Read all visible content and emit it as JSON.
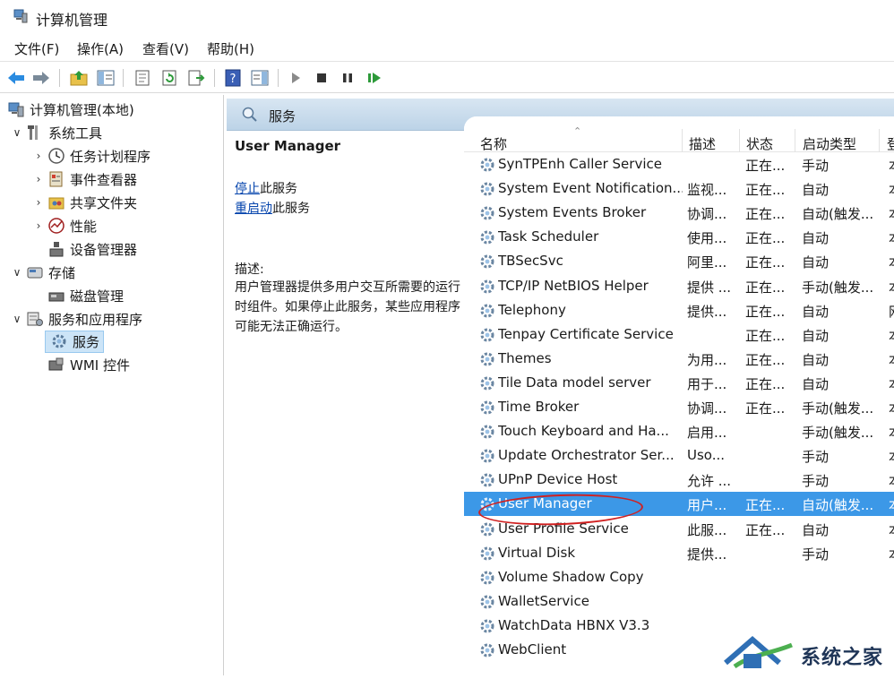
{
  "window": {
    "title": "计算机管理"
  },
  "menu": [
    {
      "label": "文件(F)"
    },
    {
      "label": "操作(A)"
    },
    {
      "label": "查看(V)"
    },
    {
      "label": "帮助(H)"
    }
  ],
  "tree": {
    "root": "计算机管理(本地)",
    "system_tools": "系统工具",
    "task_scheduler": "任务计划程序",
    "event_viewer": "事件查看器",
    "shared_folders": "共享文件夹",
    "performance": "性能",
    "device_manager": "设备管理器",
    "storage": "存储",
    "disk_management": "磁盘管理",
    "services_apps": "服务和应用程序",
    "services": "服务",
    "wmi": "WMI 控件"
  },
  "header": {
    "title": "服务"
  },
  "details": {
    "service_name": "User Manager",
    "stop_link": "停止",
    "stop_suffix": "此服务",
    "restart_link": "重启动",
    "restart_suffix": "此服务",
    "desc_label": "描述:",
    "description": "用户管理器提供多用户交互所需要的运行时组件。如果停止此服务，某些应用程序可能无法正确运行。"
  },
  "columns": {
    "name": "名称",
    "description": "描述",
    "status": "状态",
    "startup": "启动类型",
    "logon": "登"
  },
  "rows": [
    {
      "name": "SynTPEnh Caller Service",
      "description": "",
      "status": "正在...",
      "startup": "手动",
      "logon": "本"
    },
    {
      "name": "System Event Notification...",
      "description": "监视...",
      "status": "正在...",
      "startup": "自动",
      "logon": "本"
    },
    {
      "name": "System Events Broker",
      "description": "协调...",
      "status": "正在...",
      "startup": "自动(触发...",
      "logon": "本"
    },
    {
      "name": "Task Scheduler",
      "description": "使用...",
      "status": "正在...",
      "startup": "自动",
      "logon": "本"
    },
    {
      "name": "TBSecSvc",
      "description": "阿里...",
      "status": "正在...",
      "startup": "自动",
      "logon": "本"
    },
    {
      "name": "TCP/IP NetBIOS Helper",
      "description": "提供 ...",
      "status": "正在...",
      "startup": "手动(触发...",
      "logon": "本"
    },
    {
      "name": "Telephony",
      "description": "提供...",
      "status": "正在...",
      "startup": "自动",
      "logon": "网"
    },
    {
      "name": "Tenpay Certificate Service",
      "description": "",
      "status": "正在...",
      "startup": "自动",
      "logon": "本"
    },
    {
      "name": "Themes",
      "description": "为用...",
      "status": "正在...",
      "startup": "自动",
      "logon": "本"
    },
    {
      "name": "Tile Data model server",
      "description": "用于...",
      "status": "正在...",
      "startup": "自动",
      "logon": "本"
    },
    {
      "name": "Time Broker",
      "description": "协调...",
      "status": "正在...",
      "startup": "手动(触发...",
      "logon": "本"
    },
    {
      "name": "Touch Keyboard and Ha...",
      "description": "启用...",
      "status": "",
      "startup": "手动(触发...",
      "logon": "本"
    },
    {
      "name": "Update Orchestrator Ser...",
      "description": "Uso...",
      "status": "",
      "startup": "手动",
      "logon": "本"
    },
    {
      "name": "UPnP Device Host",
      "description": "允许 ...",
      "status": "",
      "startup": "手动",
      "logon": "本"
    },
    {
      "name": "User Manager",
      "description": "用户...",
      "status": "正在...",
      "startup": "自动(触发...",
      "logon": "本"
    },
    {
      "name": "User Profile Service",
      "description": "此服...",
      "status": "正在...",
      "startup": "自动",
      "logon": "本"
    },
    {
      "name": "Virtual Disk",
      "description": "提供...",
      "status": "",
      "startup": "手动",
      "logon": "本"
    },
    {
      "name": "Volume Shadow Copy",
      "description": "",
      "status": "",
      "startup": "",
      "logon": ""
    },
    {
      "name": "WalletService",
      "description": "",
      "status": "",
      "startup": "",
      "logon": ""
    },
    {
      "name": "WatchData HBNX V3.3",
      "description": "",
      "status": "",
      "startup": "",
      "logon": ""
    },
    {
      "name": "WebClient",
      "description": "",
      "status": "",
      "startup": "",
      "logon": ""
    }
  ],
  "selected_row": "User Manager",
  "watermark": {
    "text": "系统之家"
  },
  "colors": {
    "selection": "#3c98e7",
    "header_band": "#c9dcec",
    "link": "#0645ad",
    "annotation": "#d02020"
  }
}
